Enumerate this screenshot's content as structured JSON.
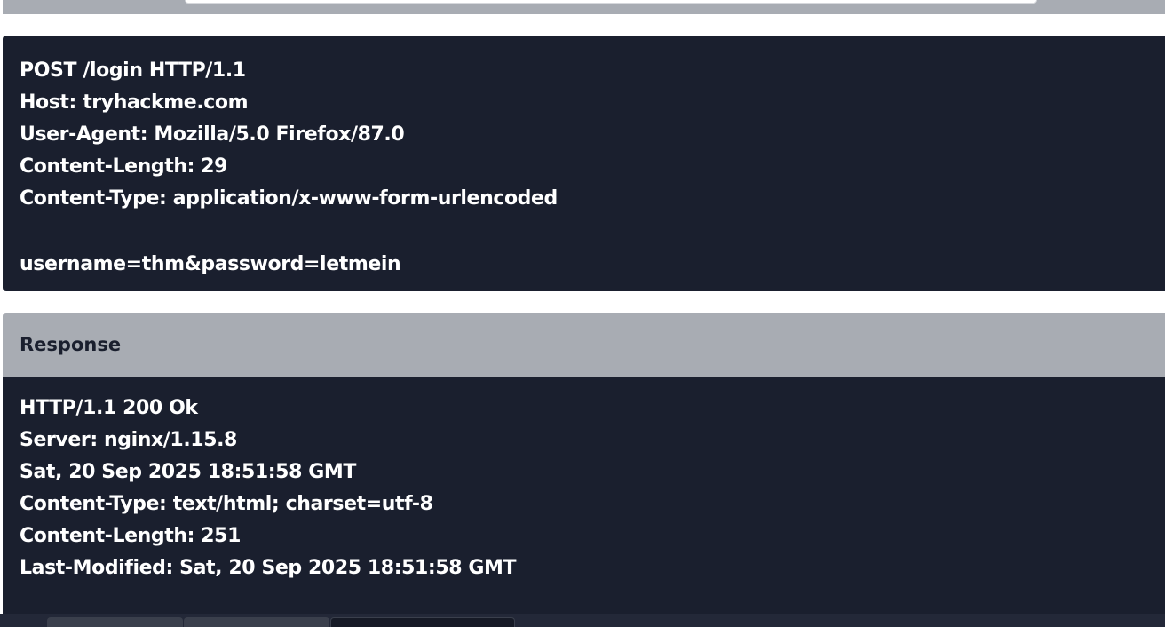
{
  "request": {
    "lines": [
      "POST /login HTTP/1.1",
      "Host: tryhackme.com",
      "User-Agent: Mozilla/5.0 Firefox/87.0",
      "Content-Length: 29",
      "Content-Type: application/x-www-form-urlencoded"
    ],
    "body": "username=thm&password=letmein"
  },
  "response": {
    "title": "Response",
    "lines": [
      "HTTP/1.1 200 Ok",
      "Server: nginx/1.15.8",
      "Sat, 20 Sep 2025 18:51:58 GMT",
      "Content-Type: text/html; charset=utf-8",
      "Content-Length: 251",
      "Last-Modified: Sat, 20 Sep 2025 18:51:58 GMT"
    ]
  },
  "colors": {
    "code_background": "#1a1f2e",
    "header_background": "#a8acb3",
    "text": "#ffffff"
  }
}
